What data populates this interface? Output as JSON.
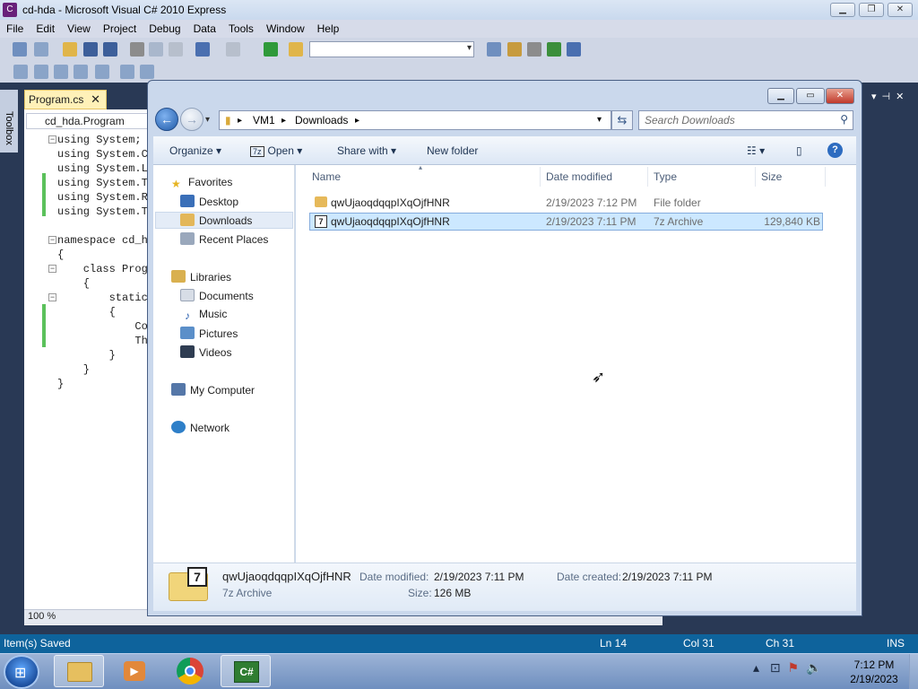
{
  "vs": {
    "title": "cd-hda - Microsoft Visual C# 2010 Express",
    "menu": [
      "File",
      "Edit",
      "View",
      "Project",
      "Debug",
      "Data",
      "Tools",
      "Window",
      "Help"
    ],
    "toolbox_label": "Toolbox",
    "doc_tab": "Program.cs",
    "nav_combo": "cd_hda.Program",
    "code_lines": [
      "using System;",
      "using System.C",
      "using System.L",
      "using System.T",
      "using System.R",
      "using System.T",
      "",
      "namespace cd_h",
      "{",
      "    class Prog",
      "    {",
      "        static",
      "        {",
      "            Co",
      "            Th",
      "        }",
      "    }",
      "}"
    ],
    "zoom": "100 %",
    "status": {
      "message": "Item(s) Saved",
      "line": "Ln 14",
      "col": "Col 31",
      "ch": "Ch 31",
      "mode": "INS"
    }
  },
  "explorer": {
    "breadcrumb": [
      "VM1",
      "Downloads"
    ],
    "search_placeholder": "Search Downloads",
    "commands": {
      "organize": "Organize",
      "open": "Open",
      "share": "Share with",
      "new_folder": "New folder"
    },
    "nav": {
      "favorites": "Favorites",
      "desktop": "Desktop",
      "downloads": "Downloads",
      "recent": "Recent Places",
      "libraries": "Libraries",
      "documents": "Documents",
      "music": "Music",
      "pictures": "Pictures",
      "videos": "Videos",
      "computer": "My Computer",
      "network": "Network"
    },
    "columns": {
      "name": "Name",
      "date": "Date modified",
      "type": "Type",
      "size": "Size"
    },
    "files": [
      {
        "name": "qwUjaoqdqqpIXqOjfHNR",
        "date": "2/19/2023 7:12 PM",
        "type": "File folder",
        "size": ""
      },
      {
        "name": "qwUjaoqdqqpIXqOjfHNR",
        "date": "2/19/2023 7:11 PM",
        "type": "7z Archive",
        "size": "129,840 KB"
      }
    ],
    "details": {
      "name": "qwUjaoqdqqpIXqOjfHNR",
      "kind": "7z Archive",
      "modified_label": "Date modified:",
      "modified": "2/19/2023 7:11 PM",
      "created_label": "Date created:",
      "created": "2/19/2023 7:11 PM",
      "size_label": "Size:",
      "size": "126 MB"
    }
  },
  "taskbar": {
    "time": "7:12 PM",
    "date": "2/19/2023"
  }
}
